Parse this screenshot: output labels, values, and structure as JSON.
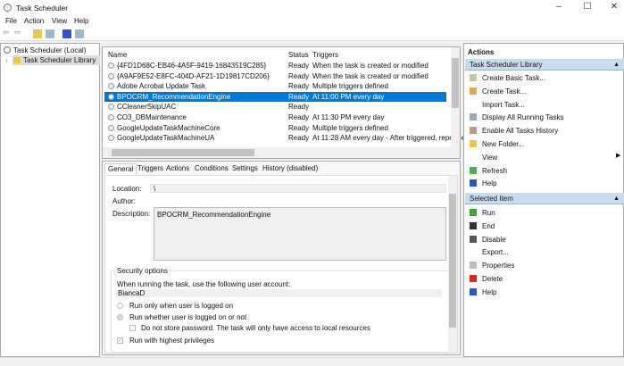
{
  "window": {
    "title": "Task Scheduler",
    "controls": [
      "–",
      "☐",
      "✕"
    ]
  },
  "menu": [
    "File",
    "Action",
    "View",
    "Help"
  ],
  "tree": {
    "root": "Task Scheduler (Local)",
    "child": "Task Scheduler Library"
  },
  "tasks": {
    "columns": [
      "Name",
      "Status",
      "Triggers"
    ],
    "rows": [
      {
        "name": "{4FD1D68C-EB46-4A5F-9419-16843519C285}",
        "status": "Ready",
        "trigger": "When the task is created or modified"
      },
      {
        "name": "{A9AF9E52-E8FC-404D-AF21-1D19817CD206}",
        "status": "Ready",
        "trigger": "When the task is created or modified"
      },
      {
        "name": "Adobe Acrobat Update Task",
        "status": "Ready",
        "trigger": "Multiple triggers defined"
      },
      {
        "name": "BPOCRM_RecommendationEngine",
        "status": "Ready",
        "trigger": "At 11:00 PM every day",
        "selected": true
      },
      {
        "name": "CCleanerSkipUAC",
        "status": "Ready",
        "trigger": ""
      },
      {
        "name": "CO3_DBMaintenance",
        "status": "Ready",
        "trigger": "At 11:30 PM every day"
      },
      {
        "name": "GoogleUpdateTaskMachineCore",
        "status": "Ready",
        "trigger": "Multiple triggers defined"
      },
      {
        "name": "GoogleUpdateTaskMachineUA",
        "status": "Ready",
        "trigger": "At 11:28 AM every day - After triggered, repeat e"
      }
    ]
  },
  "details": {
    "tabs": [
      "General",
      "Triggers",
      "Actions",
      "Conditions",
      "Settings",
      "History (disabled)"
    ],
    "location_label": "Location:",
    "location": "\\",
    "author_label": "Author:",
    "description_label": "Description:",
    "description": "BPOCRM_RecommendationEngine",
    "security_title": "Security options",
    "account_prompt": "When running the task, use the following user account:",
    "account": "BiancaD",
    "opt_logged_on": "Run only when user is logged on",
    "opt_whether": "Run whether user is logged on or not",
    "opt_no_password": "Do not store password.  The task will only have access to local resources",
    "opt_highest": "Run with highest privileges"
  },
  "actions": {
    "header": "Actions",
    "section1": "Task Scheduler Library",
    "items1": [
      "Create Basic Task...",
      "Create Task...",
      "Import Task...",
      "Display All Running Tasks",
      "Enable All Tasks History",
      "New Folder...",
      "View",
      "Refresh",
      "Help"
    ],
    "section2": "Selected Item",
    "items2": [
      "Run",
      "End",
      "Disable",
      "Export...",
      "Properties",
      "Delete",
      "Help"
    ]
  },
  "colors": {
    "selection": "#0078d7",
    "section": "#c9dcef"
  }
}
